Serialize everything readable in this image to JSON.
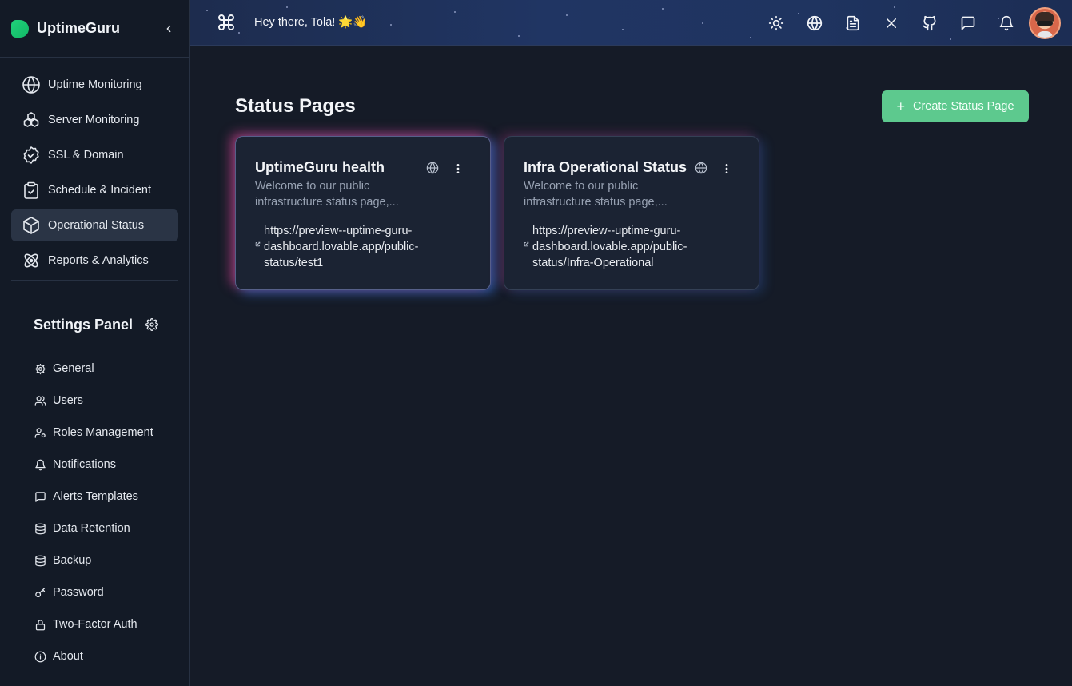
{
  "app": {
    "name": "UptimeGuru"
  },
  "nav": {
    "items": [
      {
        "label": "Uptime Monitoring",
        "icon": "globe-icon",
        "active": false
      },
      {
        "label": "Server Monitoring",
        "icon": "server-cluster-icon",
        "active": false
      },
      {
        "label": "SSL & Domain",
        "icon": "badge-check-icon",
        "active": false
      },
      {
        "label": "Schedule & Incident",
        "icon": "clipboard-check-icon",
        "active": false
      },
      {
        "label": "Operational Status",
        "icon": "box-icon",
        "active": true
      },
      {
        "label": "Reports & Analytics",
        "icon": "atom-icon",
        "active": false
      }
    ]
  },
  "settings": {
    "title": "Settings Panel",
    "items": [
      {
        "label": "General",
        "icon": "gear-icon"
      },
      {
        "label": "Users",
        "icon": "users-icon"
      },
      {
        "label": "Roles Management",
        "icon": "user-cog-icon"
      },
      {
        "label": "Notifications",
        "icon": "bell-icon"
      },
      {
        "label": "Alerts Templates",
        "icon": "message-icon"
      },
      {
        "label": "Data Retention",
        "icon": "database-icon"
      },
      {
        "label": "Backup",
        "icon": "database-icon"
      },
      {
        "label": "Password",
        "icon": "key-icon"
      },
      {
        "label": "Two-Factor Auth",
        "icon": "lock-icon"
      },
      {
        "label": "About",
        "icon": "info-icon"
      }
    ]
  },
  "topbar": {
    "greeting": "Hey there, Tola! 🌟👋",
    "icons": [
      "sun-icon",
      "globe-icon",
      "document-icon",
      "x-icon",
      "github-icon",
      "chat-icon",
      "bell-icon",
      "avatar"
    ]
  },
  "main": {
    "title": "Status Pages",
    "create_label": "Create Status Page",
    "cards": [
      {
        "title": "UptimeGuru health",
        "description": "Welcome to our public infrastructure status page,...",
        "url": "https://preview--uptime-guru-dashboard.lovable.app/public-status/test1"
      },
      {
        "title": "Infra Operational Status",
        "description": "Welcome to our public infrastructure status page,...",
        "url": "https://preview--uptime-guru-dashboard.lovable.app/public-status/Infra-Operational"
      }
    ]
  },
  "colors": {
    "accent": "#5dc98e",
    "background": "#151b27",
    "sidebar": "#131a26",
    "active_nav": "#2a3445"
  }
}
